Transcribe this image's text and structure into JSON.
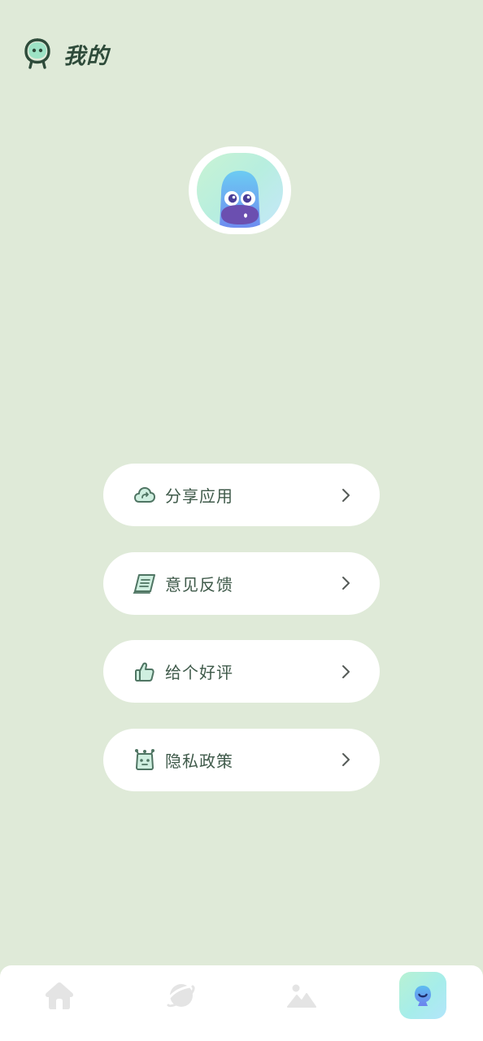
{
  "header": {
    "title": "我的",
    "icon": "ghost-face-icon"
  },
  "avatar": {
    "icon": "blue-ghost-avatar-icon"
  },
  "menu": {
    "items": [
      {
        "label": "分享应用",
        "icon": "cloud-share-icon",
        "chevron": "chevron-right-icon"
      },
      {
        "label": "意见反馈",
        "icon": "feedback-book-icon",
        "chevron": "chevron-right-icon"
      },
      {
        "label": "给个好评",
        "icon": "thumbs-up-icon",
        "chevron": "chevron-right-icon"
      },
      {
        "label": "隐私政策",
        "icon": "robot-face-icon",
        "chevron": "chevron-right-icon"
      }
    ]
  },
  "tabbar": {
    "tabs": [
      {
        "icon": "home-icon",
        "active": false
      },
      {
        "icon": "planet-icon",
        "active": false
      },
      {
        "icon": "image-icon",
        "active": false
      },
      {
        "icon": "profile-ghost-icon",
        "active": true
      }
    ]
  },
  "colors": {
    "background": "#DFEAD8",
    "card": "#FFFFFF",
    "text": "#3F5A4A",
    "title": "#2E4B3A",
    "icon_stroke": "#4F7563",
    "icon_fill": "#CFEFE0",
    "tab_inactive": "#E4E4E4",
    "tab_active_gradient": "#B8F2D3"
  }
}
